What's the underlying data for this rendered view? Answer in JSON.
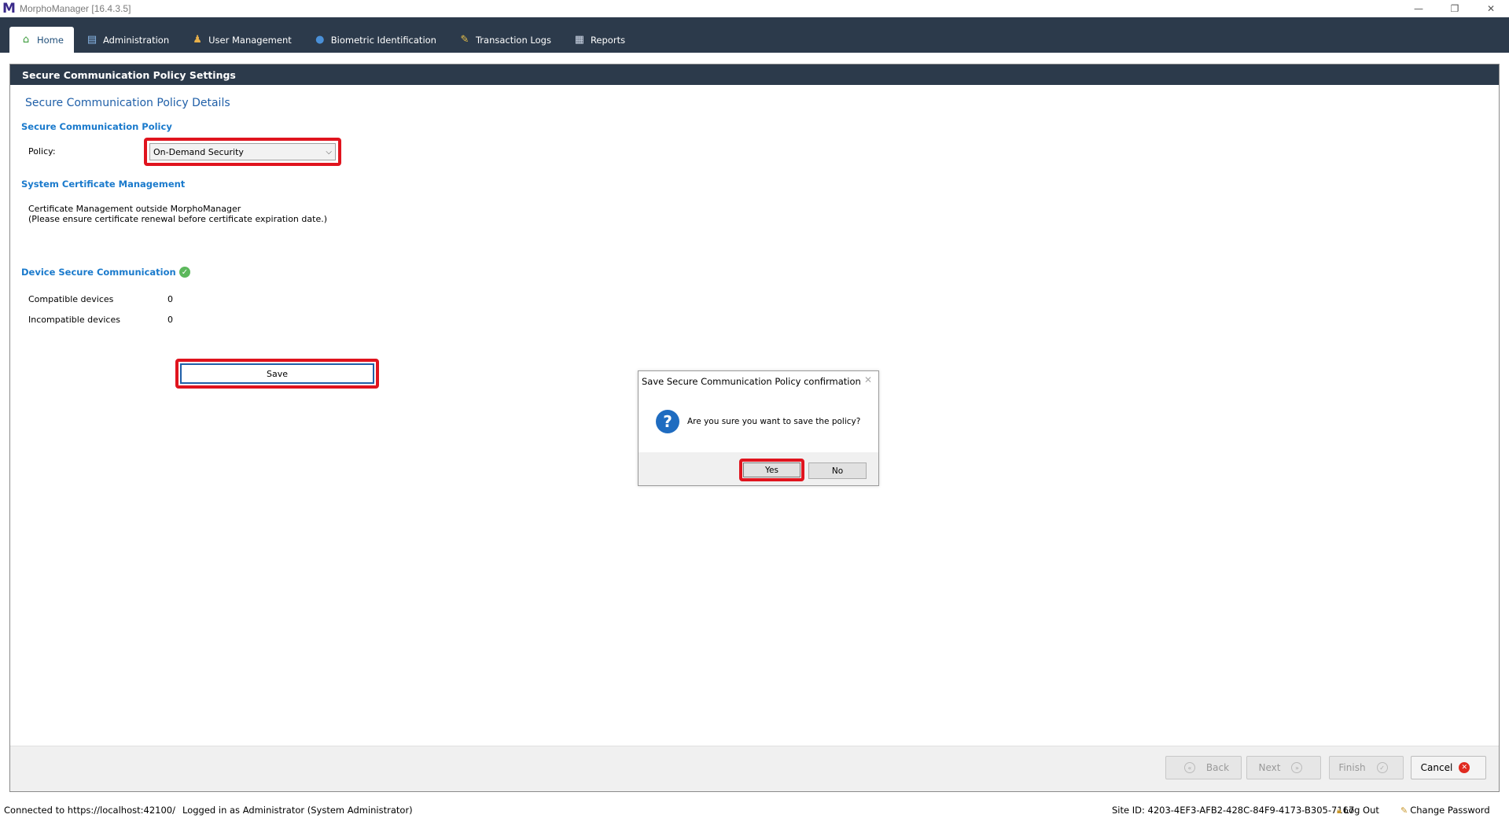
{
  "window": {
    "title": "MorphoManager [16.4.3.5]",
    "logo_letter": "M",
    "minimize": "—",
    "restore": "❐",
    "close": "✕"
  },
  "tabs": [
    {
      "label": "Home",
      "icon": "home-icon",
      "active": true
    },
    {
      "label": "Administration",
      "icon": "administration-icon",
      "active": false
    },
    {
      "label": "User Management",
      "icon": "users-icon",
      "active": false
    },
    {
      "label": "Biometric Identification",
      "icon": "globe-icon",
      "active": false
    },
    {
      "label": "Transaction Logs",
      "icon": "log-icon",
      "active": false
    },
    {
      "label": "Reports",
      "icon": "reports-icon",
      "active": false
    }
  ],
  "panel": {
    "header": "Secure Communication Policy Settings",
    "details_title": "Secure Communication Policy Details",
    "policy_section": "Secure Communication Policy",
    "policy_label": "Policy:",
    "policy_value": "On-Demand Security",
    "cert_section": "System Certificate Management",
    "cert_line1": "Certificate Management outside MorphoManager",
    "cert_line2": "(Please ensure certificate renewal before certificate expiration date.)",
    "device_section": "Device Secure Communication",
    "compatible_label": "Compatible devices",
    "compatible_value": "0",
    "incompatible_label": "Incompatible devices",
    "incompatible_value": "0",
    "save_label": "Save"
  },
  "footer": {
    "back": "Back",
    "next": "Next",
    "finish": "Finish",
    "cancel": "Cancel"
  },
  "dialog": {
    "title": "Save Secure Communication Policy confirmation",
    "message": "Are you sure you want to save the policy?",
    "yes": "Yes",
    "no": "No"
  },
  "status": {
    "connected": "Connected to https://localhost:42100/",
    "logged_in": "Logged in as Administrator (System Administrator)",
    "site_id": "Site ID: 4203-4EF3-AFB2-428C-84F9-4173-B305-7167",
    "logout": "Log Out",
    "change_password": "Change Password"
  },
  "colors": {
    "header_bg": "#2c3a4b",
    "highlight": "#e0141e",
    "section_blue": "#1a7acc"
  }
}
